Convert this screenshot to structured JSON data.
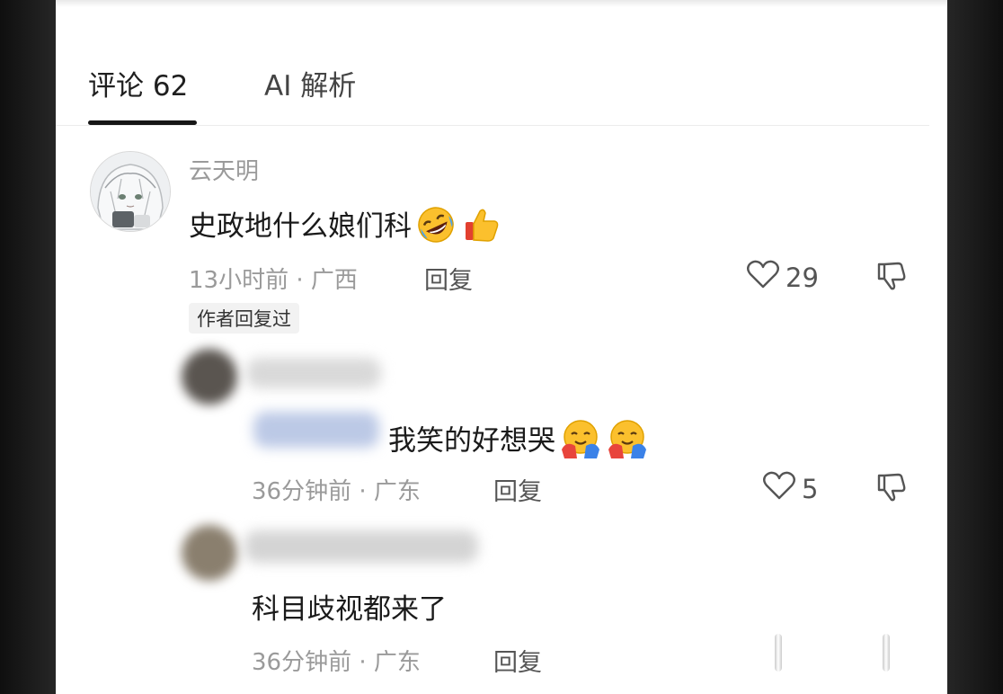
{
  "tabs": {
    "comments": "评论 62",
    "ai": "AI 解析"
  },
  "comments": [
    {
      "username": "云天明",
      "text": "史政地什么娘们科",
      "time": "13小时前 · 广西",
      "reply": "回复",
      "likes": "29",
      "badge": "作者回复过",
      "emojis": [
        "rolling-on-floor-laughing",
        "thumbs-up"
      ]
    },
    {
      "text": "我笑的好想哭",
      "time": "36分钟前 · 广东",
      "reply": "回复",
      "likes": "5",
      "emojis": [
        "hugging-face",
        "hugging-face"
      ]
    },
    {
      "text": "科目歧视都来了",
      "time": "36分钟前 · 广东",
      "reply": "回复"
    }
  ],
  "colors": {
    "text": "#1a1a1a",
    "muted": "#9a9a9a",
    "mention": "#2c5cc5",
    "background": "#ffffff",
    "frame": "#1a1a1a"
  }
}
